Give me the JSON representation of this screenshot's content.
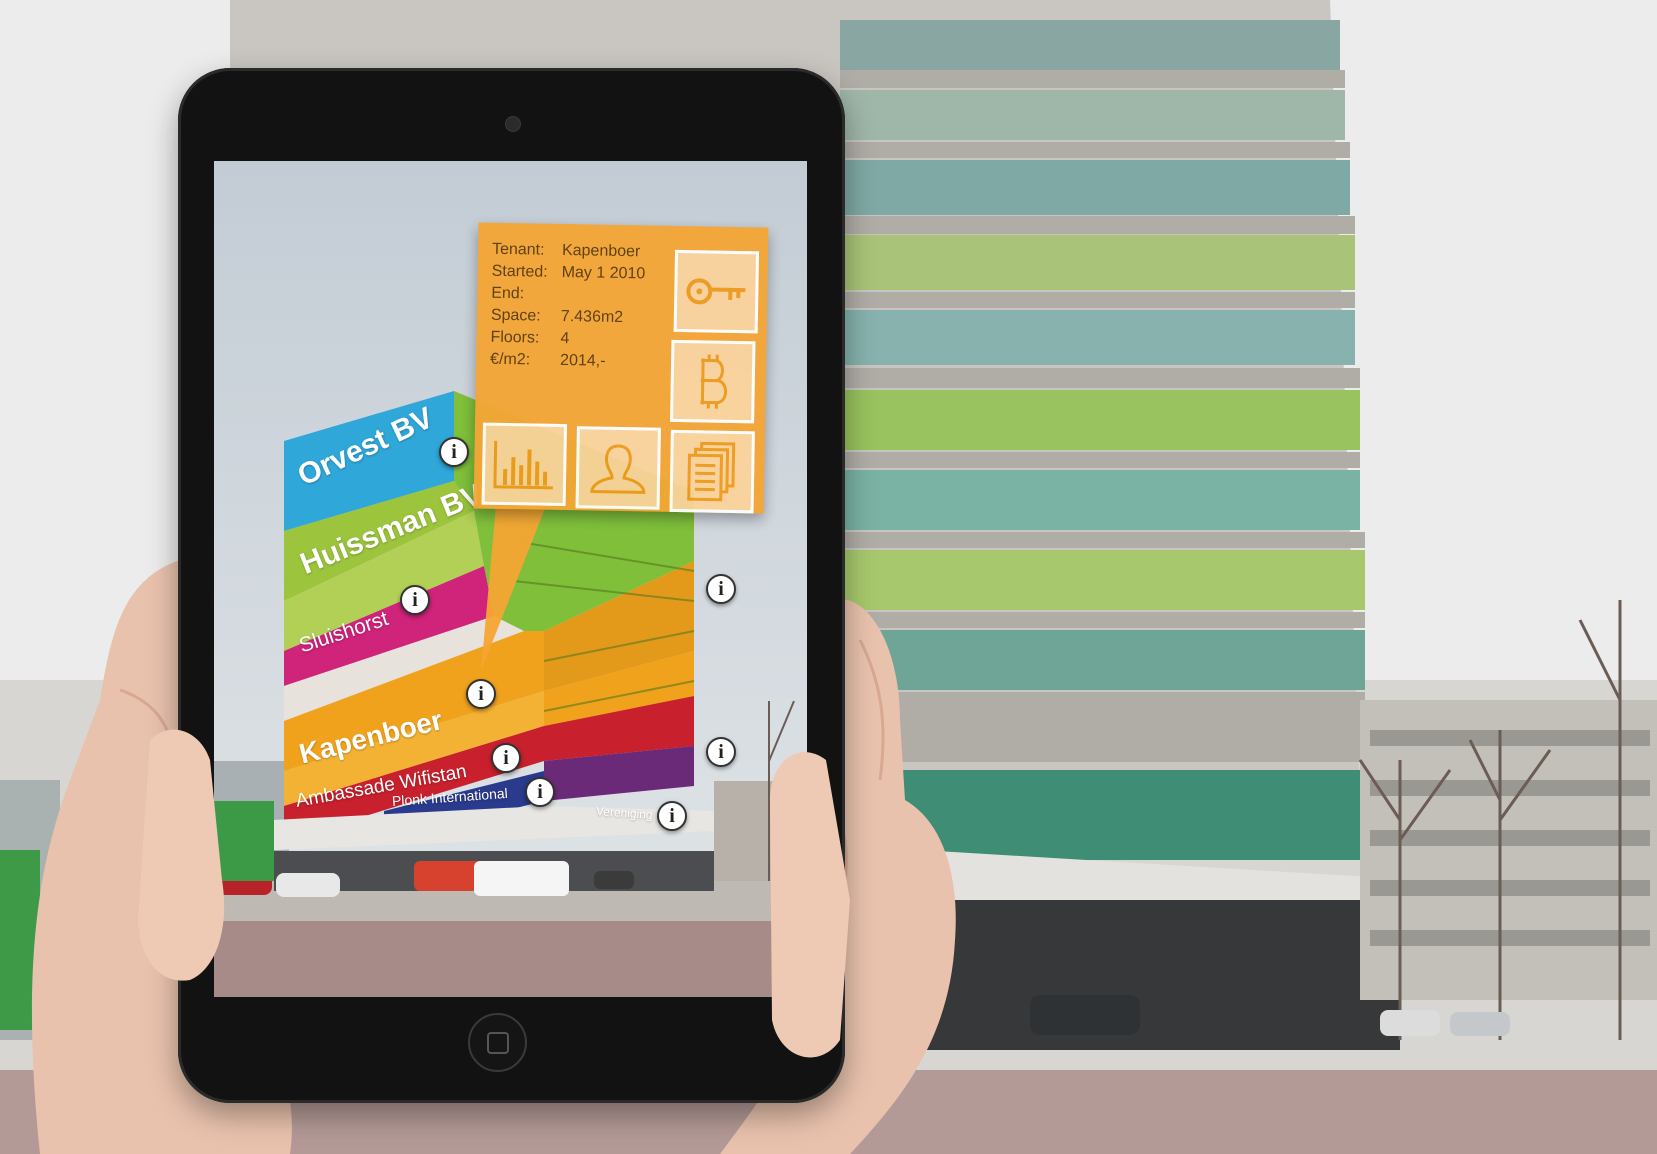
{
  "info_panel": {
    "rows": [
      {
        "key": "Tenant:",
        "value": "Kapenboer"
      },
      {
        "key": "Started:",
        "value": "May 1 2010"
      },
      {
        "key": "End:",
        "value": ""
      },
      {
        "key": "Space:",
        "value": "7.436m2"
      },
      {
        "key": "Floors:",
        "value": "4"
      },
      {
        "key": "€/m2:",
        "value": "2014,-"
      }
    ],
    "tiles": [
      "key-icon",
      "bitcoin-icon",
      "bar-chart-icon",
      "person-icon",
      "documents-icon"
    ]
  },
  "floors": [
    {
      "name": "Orvest BV",
      "color": "#2fa7d9"
    },
    {
      "name": "Huissman BV",
      "color": "#9cc43c"
    },
    {
      "name": "Sluishorst",
      "color": "#d0237a"
    },
    {
      "name": "Kapenboer",
      "color": "#f0a21c"
    },
    {
      "name": "Ambassade Wifistan",
      "color": "#c8202c"
    },
    {
      "name": "Plonk International",
      "color": "#2a3a8c"
    },
    {
      "name": "Vereniging",
      "color": "#7a2a8a"
    }
  ],
  "info_icon_glyph": "i",
  "colors": {
    "panel": "#f5a534",
    "tablet": "#121212"
  }
}
